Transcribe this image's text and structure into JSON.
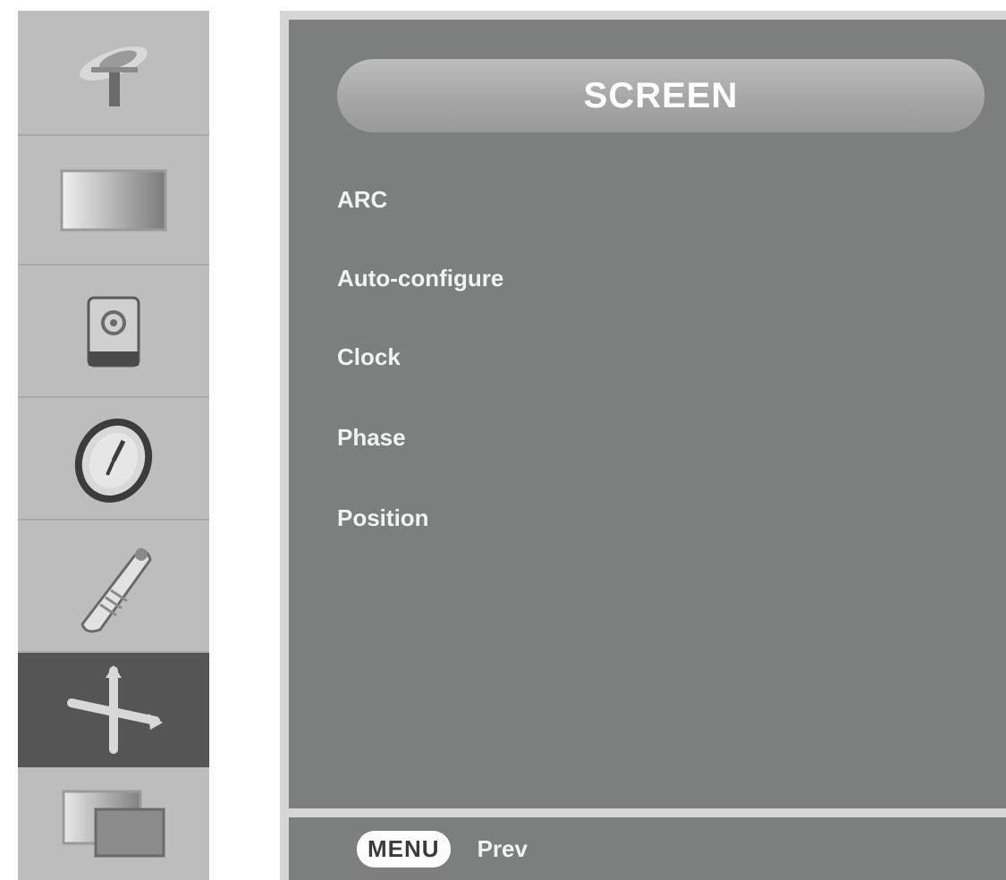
{
  "sidebar": {
    "items": [
      {
        "icon": "satellite-icon",
        "active": false
      },
      {
        "icon": "picture-icon",
        "active": false
      },
      {
        "icon": "sound-icon",
        "active": false
      },
      {
        "icon": "time-icon",
        "active": false
      },
      {
        "icon": "settings-icon",
        "active": false
      },
      {
        "icon": "screen-icon",
        "active": true
      },
      {
        "icon": "pip-icon",
        "active": false
      }
    ]
  },
  "main": {
    "title": "SCREEN",
    "items": [
      {
        "label": "ARC"
      },
      {
        "label": "Auto-configure"
      },
      {
        "label": "Clock"
      },
      {
        "label": "Phase"
      },
      {
        "label": "Position"
      }
    ]
  },
  "footer": {
    "menu_button": "MENU",
    "prev_label": "Prev"
  },
  "colors": {
    "panel": "#7d7e7e",
    "sidebar": "#bdbdbd",
    "active": "#555555",
    "text": "#f2f2f2"
  }
}
